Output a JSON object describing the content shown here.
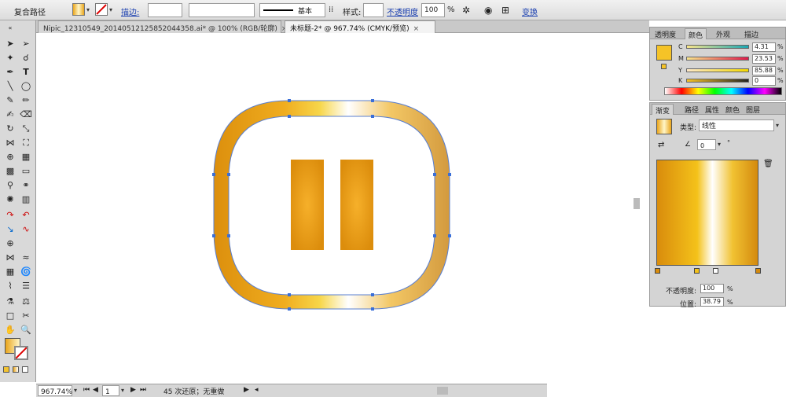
{
  "control_bar": {
    "object_type": "复合路径",
    "stroke_label": "描边:",
    "stroke_weight": "",
    "brush_value": "",
    "line_style": "基本",
    "style_label": "样式:",
    "opacity_label": "不透明度",
    "opacity_value": "100",
    "opacity_unit": "%",
    "transform_label": "变换"
  },
  "doc_tabs": [
    {
      "label": "Nipic_12310549_20140512125852044358.ai* @ 100% (RGB/轮廓)",
      "close": "×"
    },
    {
      "label": "未标题-2* @ 967.74% (CMYK/预览)",
      "close": "×"
    }
  ],
  "color_panel": {
    "tabs": [
      "透明度",
      "颜色",
      "外观",
      "描边"
    ],
    "channels": [
      {
        "name": "C",
        "value": "4.31",
        "unit": "%"
      },
      {
        "name": "M",
        "value": "23.53",
        "unit": "%"
      },
      {
        "name": "Y",
        "value": "85.88",
        "unit": "%"
      },
      {
        "name": "K",
        "value": "0",
        "unit": "%"
      }
    ],
    "fill_color": "#f5c327"
  },
  "gradient_panel": {
    "tabs": [
      "渐变",
      "路径",
      "属性",
      "颜色",
      "图层"
    ],
    "type_label": "类型:",
    "type_value": "线性",
    "angle_value": "0",
    "angle_unit": "°",
    "opacity_label": "不透明度:",
    "opacity_value": "100",
    "opacity_unit": "%",
    "position_label": "位置:",
    "position_value": "38.79",
    "position_unit": "%",
    "colors": [
      "#d98c0c",
      "#f4c21a",
      "#ffffff",
      "#f1c232",
      "#d48a0e"
    ]
  },
  "status_bar": {
    "zoom": "967.74%",
    "page": "1",
    "undo_text": "45 次还原；无重做"
  },
  "artwork": {
    "gradient_colors": [
      "#dc8f0d",
      "#f3b92a",
      "#f7d64a",
      "#ffffff",
      "#d9a44a"
    ],
    "pause_bar_color": "#e1960e"
  }
}
